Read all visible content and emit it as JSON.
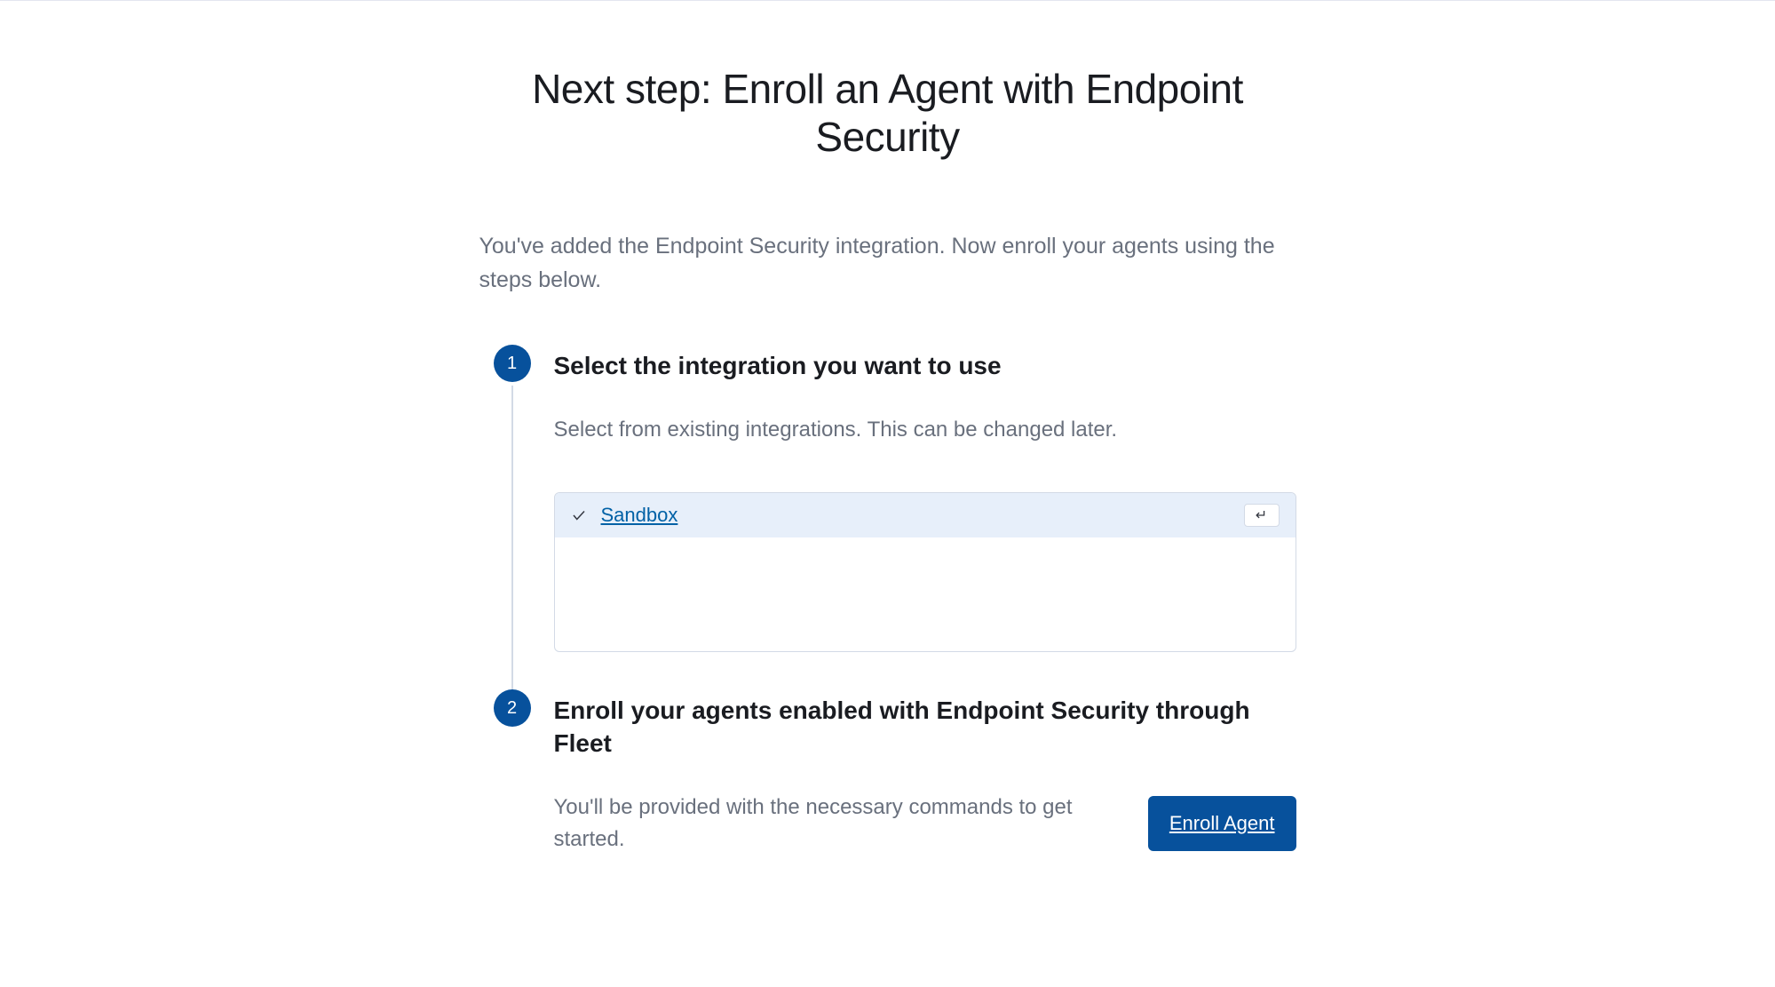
{
  "header": {
    "title": "Next step: Enroll an Agent with Endpoint Security",
    "subtitle": "You've added the Endpoint Security integration. Now enroll your agents using the steps below."
  },
  "steps": [
    {
      "number": "1",
      "title": "Select the integration you want to use",
      "description": "Select from existing integrations. This can be changed later.",
      "selection": "Sandbox"
    },
    {
      "number": "2",
      "title": "Enroll your agents enabled with Endpoint Security through Fleet",
      "description": "You'll be provided with the necessary commands to get started.",
      "button": "Enroll Agent"
    }
  ]
}
